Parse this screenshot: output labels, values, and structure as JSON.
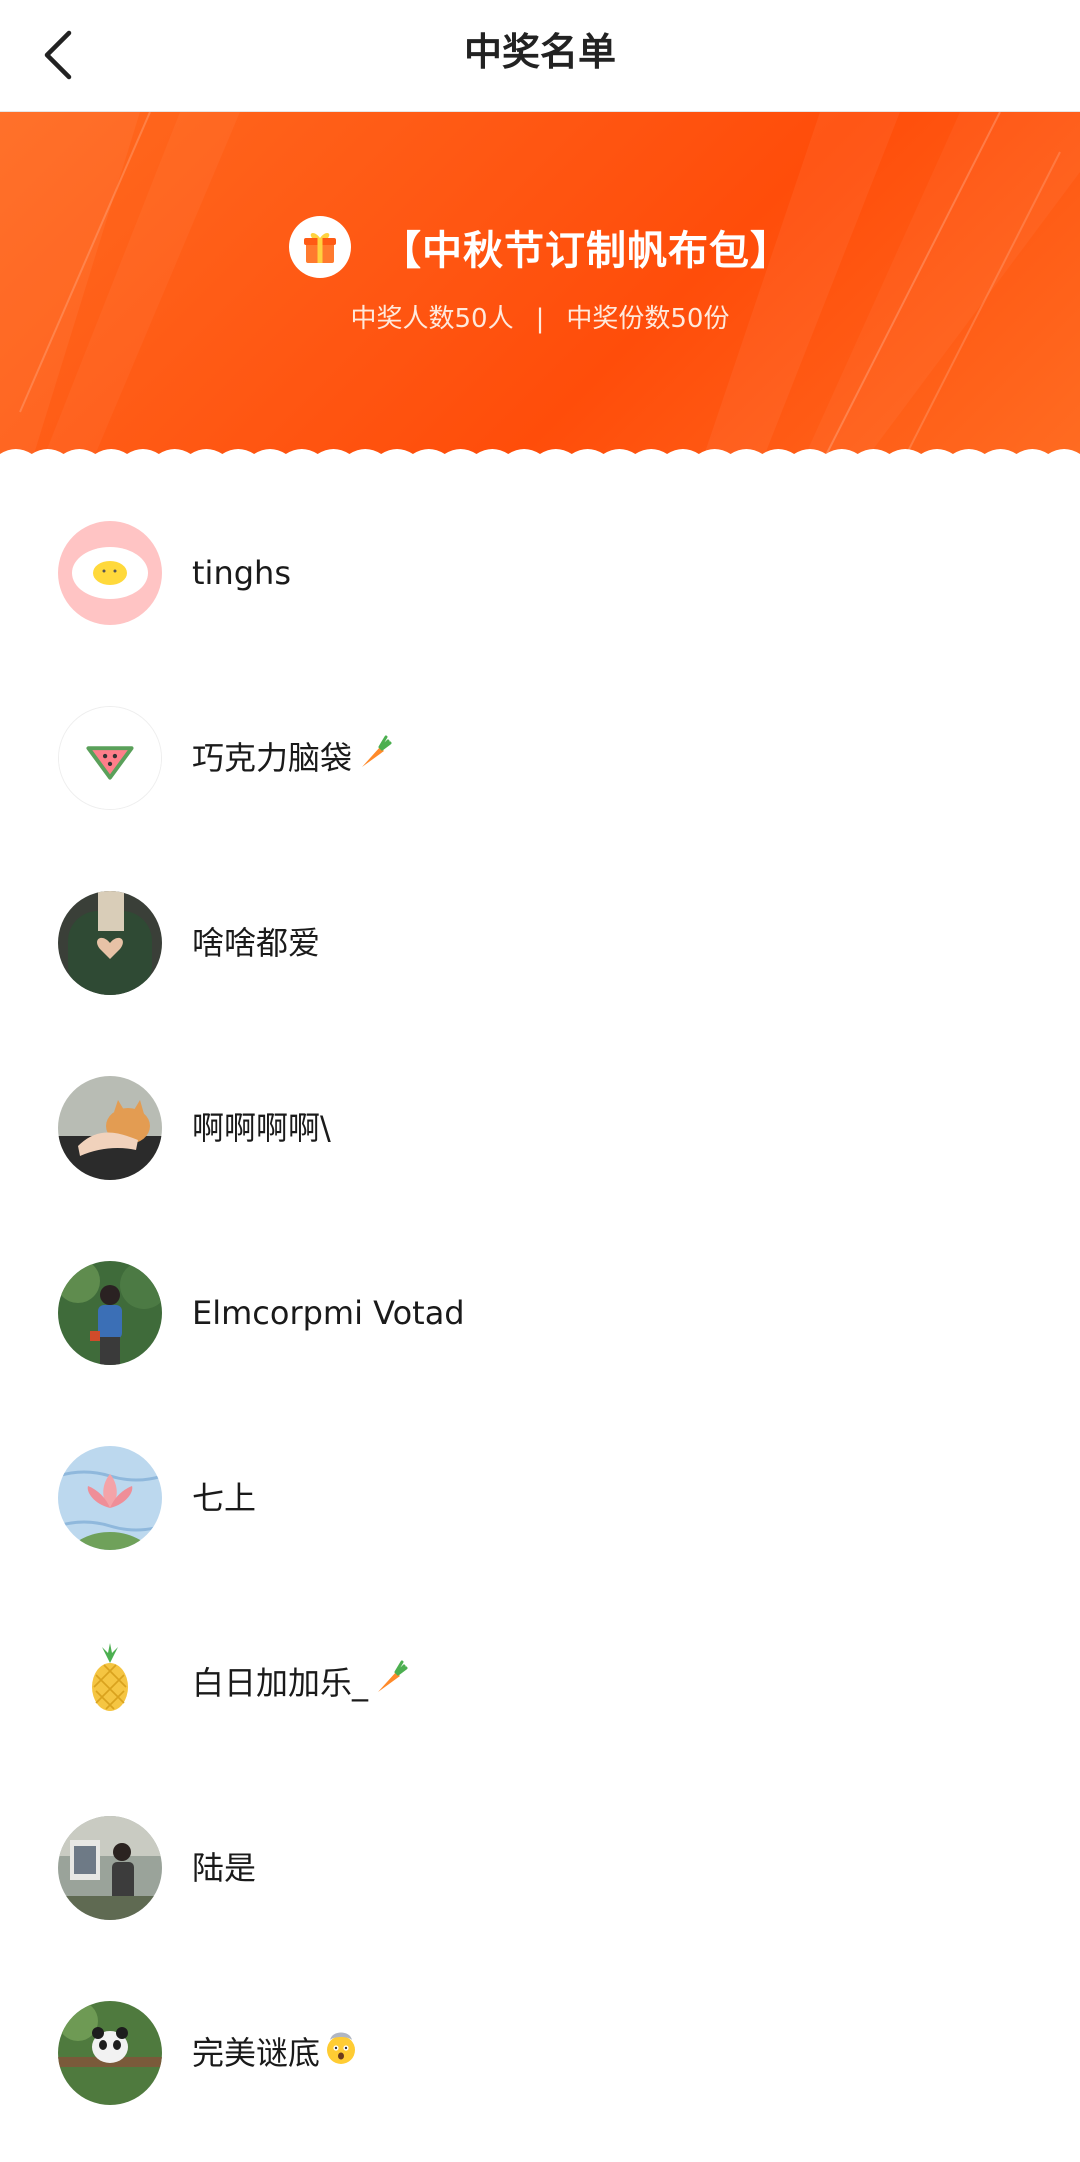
{
  "nav": {
    "title": "中奖名单",
    "back_icon": "chevron-left-icon"
  },
  "banner": {
    "gift_icon": "gift-box-icon",
    "title": "【中秋节订制帆布包】",
    "winners_count_text": "中奖人数50人",
    "separator": "|",
    "prizes_count_text": "中奖份数50份",
    "colors": {
      "accent": "#ff5a14",
      "text": "#ffffff"
    }
  },
  "winners": [
    {
      "name": "tinghs",
      "avatar": "fried-egg-avatar"
    },
    {
      "name": "巧克力脑袋",
      "suffix_emoji": "carrot-icon",
      "avatar": "watermelon-avatar"
    },
    {
      "name": "啥啥都爱",
      "avatar": "heart-hands-photo-avatar"
    },
    {
      "name": "啊啊啊啊\\",
      "avatar": "cat-hand-photo-avatar"
    },
    {
      "name": "Elmcorpmi Votad",
      "avatar": "woman-in-forest-photo-avatar"
    },
    {
      "name": "七上",
      "avatar": "lotus-painting-avatar"
    },
    {
      "name": "白日加加乐_",
      "suffix_emoji": "carrot-icon",
      "avatar": "pineapple-avatar"
    },
    {
      "name": "陆是",
      "avatar": "street-photo-avatar"
    },
    {
      "name": "完美谜底",
      "suffix_emoji": "exploding-head-icon",
      "avatar": "panda-photo-avatar"
    }
  ]
}
